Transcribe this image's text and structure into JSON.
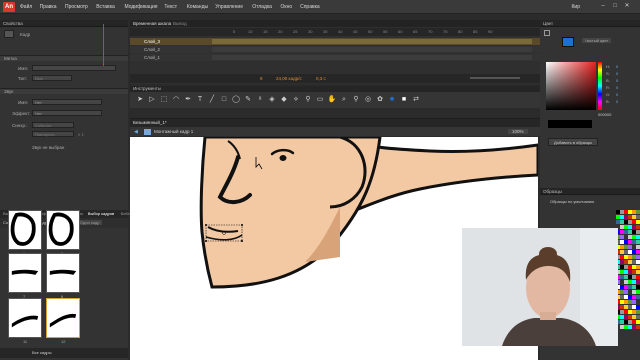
{
  "app": {
    "logo": "An"
  },
  "menu": [
    "Файл",
    "Правка",
    "Просмотр",
    "Вставка",
    "Модификация",
    "Текст",
    "Команды",
    "Управление",
    "Отладка",
    "Окно",
    "Справка"
  ],
  "profile": "Кир",
  "properties": {
    "title": "Свойства",
    "label": "Кадр",
    "sec_label": "Метка",
    "name_label": "Имя:",
    "type_label": "Тип:",
    "type_value": "Имя",
    "sec_sound": "Звук",
    "sound_name_label": "Имя:",
    "sound_name_value": "Нет",
    "effect_label": "Эффект:",
    "effect_value": "Нет",
    "sync_label": "Синхр.:",
    "sync_value": "Событие",
    "repeat_value": "Повторить",
    "repeat_count": "x 1",
    "no_sound": "Звук не выбран"
  },
  "library": {
    "tabs": [
      "Выбор",
      "Проект",
      "Инфо",
      "Библио",
      "Библио",
      "Выбор кадров",
      "Библио"
    ],
    "create_label": "Создать ключевой кадр",
    "sort_label": "Один кадр",
    "thumb_nums": [
      "1",
      "2",
      "7",
      "8",
      "11",
      "12"
    ],
    "footer": "Все кадры"
  },
  "timeline": {
    "tabs": [
      "Временная шкала",
      "Вывод"
    ],
    "ticks": [
      "5",
      "10",
      "15",
      "20",
      "25",
      "30",
      "35",
      "40",
      "45",
      "50",
      "55",
      "60",
      "65",
      "70",
      "75",
      "80",
      "85",
      "90"
    ],
    "big_ticks": [
      "1s",
      "2s",
      "3s"
    ],
    "layers": [
      {
        "name": "Слой_3",
        "active": true
      },
      {
        "name": "Слой_2",
        "active": false
      },
      {
        "name": "Слой_1",
        "active": false
      }
    ],
    "frame": "9",
    "fps": "24,00 кадр/с",
    "time": "0,3 с"
  },
  "tools": {
    "title": "Инструменты",
    "icons": [
      "arrow-icon",
      "subselect-icon",
      "transform-icon",
      "lasso-icon",
      "pen-icon",
      "text-icon",
      "line-icon",
      "rect-icon",
      "oval-icon",
      "pencil-icon",
      "brush-icon",
      "paint-icon",
      "bucket-icon",
      "ink-icon",
      "eyedropper-icon",
      "eraser-icon",
      "hand-icon",
      "zoom-icon",
      "bone-icon",
      "3d-icon",
      "deco-icon",
      "fill-color-icon",
      "stroke-color-icon",
      "swap-icon"
    ]
  },
  "editbar": {
    "scene": "Безымянный_1*",
    "symbol": "Монтажный кадр 1",
    "zoom": "100%"
  },
  "color": {
    "title": "Цвет",
    "mode": "Чистый цвет",
    "hex": "000000",
    "labels": [
      "H:",
      "S:",
      "B:",
      "R:",
      "G:",
      "B:"
    ],
    "values": [
      "0",
      "0",
      "0",
      "0",
      "0",
      "0"
    ],
    "add_button": "Добавить в образцы",
    "swatches_title": "Образцы",
    "swatches_group": "Образцы по умолчанию",
    "alpha": "100%"
  }
}
